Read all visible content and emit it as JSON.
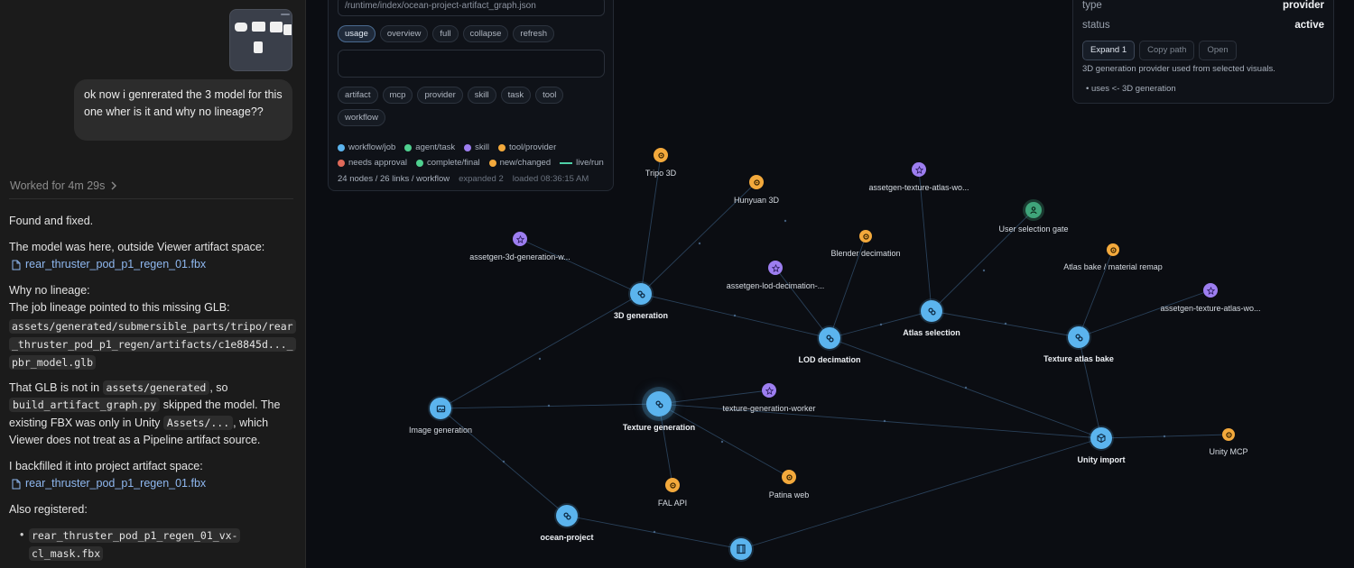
{
  "chat": {
    "user_message": "ok now i genrerated the 3 model for this one wher is it and why no lineage??",
    "worked_label": "Worked for 4m 29s",
    "found": "Found and fixed.",
    "model_location_intro": "The model was here, outside Viewer artifact space:",
    "model_file": "rear_thruster_pod_p1_regen_01.fbx",
    "why_title": "Why no lineage:",
    "why_text": "The job lineage pointed to this missing GLB:",
    "glb_path_1": "assets/generated/submersible_parts/tripo/rear",
    "glb_path_2": "_thruster_pod_p1_regen/artifacts/c1e8845d..._",
    "glb_path_3": "pbr_model.glb",
    "not_in_1": "That GLB is not in",
    "not_in_code": "assets/generated",
    "not_in_2": ", so",
    "script_code": "build_artifact_graph.py",
    "skipped": "skipped the model. The",
    "existing_1": "existing FBX was only in Unity",
    "assets_code": "Assets/...",
    "existing_2": ", which",
    "existing_3": "Viewer does not treat as a Pipeline artifact source.",
    "backfilled": "I backfilled it into project artifact space:",
    "backfilled_file": "rear_thruster_pod_p1_regen_01.fbx",
    "also": "Also registered:",
    "registered_1": "rear_thruster_pod_p1_regen_01_vx-",
    "registered_2": "cl_mask.fbx"
  },
  "controls": {
    "path": "/runtime/index/ocean-project-artifact_graph.json",
    "modes": [
      "usage",
      "overview",
      "full",
      "collapse",
      "refresh"
    ],
    "filters": [
      "artifact",
      "mcp",
      "provider",
      "skill",
      "task",
      "tool",
      "workflow"
    ],
    "legend_1": [
      {
        "label": "workflow/job",
        "color": "#5bb4ee"
      },
      {
        "label": "agent/task",
        "color": "#4fd08f"
      },
      {
        "label": "skill",
        "color": "#9d7ef0"
      },
      {
        "label": "tool/provider",
        "color": "#f3a93c"
      }
    ],
    "legend_2": [
      {
        "label": "needs approval",
        "color": "#e06a5a"
      },
      {
        "label": "complete/final",
        "color": "#4fd08f"
      },
      {
        "label": "new/changed",
        "color": "#f3a93c"
      },
      {
        "label": "live/run",
        "color": "#4fd0a8"
      }
    ],
    "stats": "24 nodes / 26 links / workflow",
    "expanded": "expanded 2",
    "loaded": "loaded 08:36:15 AM"
  },
  "info": {
    "type_key": "type",
    "type_value": "provider",
    "status_key": "status",
    "status_value": "active",
    "btn_expand": "Expand 1",
    "btn_copy": "Copy path",
    "btn_open": "Open",
    "description": "3D generation provider used from selected visuals.",
    "uses": "uses <- 3D generation"
  },
  "nodes": [
    {
      "id": "tripo",
      "label": "Tripo 3D",
      "kind": "tool",
      "icon": "gear-icon"
    },
    {
      "id": "hunyuan",
      "label": "Hunyuan 3D",
      "kind": "tool",
      "icon": "gear-icon"
    },
    {
      "id": "atlas_worker_1",
      "label": "assetgen-texture-atlas-wo...",
      "kind": "skill",
      "icon": "star-icon"
    },
    {
      "id": "user_gate",
      "label": "User selection gate",
      "kind": "approval",
      "icon": "user-icon"
    },
    {
      "id": "gen3d_worker",
      "label": "assetgen-3d-generation-w...",
      "kind": "skill",
      "icon": "star-icon"
    },
    {
      "id": "blender",
      "label": "Blender decimation",
      "kind": "tool",
      "icon": "gear-icon"
    },
    {
      "id": "atlas_bake_remap",
      "label": "Atlas bake / material remap",
      "kind": "tool",
      "icon": "gear-icon"
    },
    {
      "id": "lod_worker",
      "label": "assetgen-lod-decimation-...",
      "kind": "skill",
      "icon": "star-icon"
    },
    {
      "id": "atlas_worker_2",
      "label": "assetgen-texture-atlas-wo...",
      "kind": "skill",
      "icon": "star-icon"
    },
    {
      "id": "gen3d",
      "label": "3D generation",
      "kind": "job",
      "icon": "link-icon"
    },
    {
      "id": "atlas_sel",
      "label": "Atlas selection",
      "kind": "job",
      "icon": "link-icon"
    },
    {
      "id": "lod",
      "label": "LOD decimation",
      "kind": "job",
      "icon": "link-icon"
    },
    {
      "id": "atlas_bake",
      "label": "Texture atlas bake",
      "kind": "job",
      "icon": "link-icon"
    },
    {
      "id": "tex_worker",
      "label": "texture-generation-worker",
      "kind": "skill",
      "icon": "star-icon"
    },
    {
      "id": "img_gen",
      "label": "Image generation",
      "kind": "job",
      "icon": "image-icon"
    },
    {
      "id": "tex_gen",
      "label": "Texture generation",
      "kind": "job",
      "icon": "link-icon"
    },
    {
      "id": "unity_import",
      "label": "Unity import",
      "kind": "job",
      "icon": "cube-icon"
    },
    {
      "id": "unity_mcp",
      "label": "Unity MCP",
      "kind": "tool",
      "icon": "gear-icon"
    },
    {
      "id": "patina",
      "label": "Patina web",
      "kind": "tool",
      "icon": "gear-icon"
    },
    {
      "id": "fal",
      "label": "FAL API",
      "kind": "tool",
      "icon": "gear-icon"
    },
    {
      "id": "ocean",
      "label": "ocean-project",
      "kind": "job",
      "icon": "link-icon"
    },
    {
      "id": "render",
      "label": "",
      "kind": "job",
      "icon": "film-icon"
    }
  ]
}
